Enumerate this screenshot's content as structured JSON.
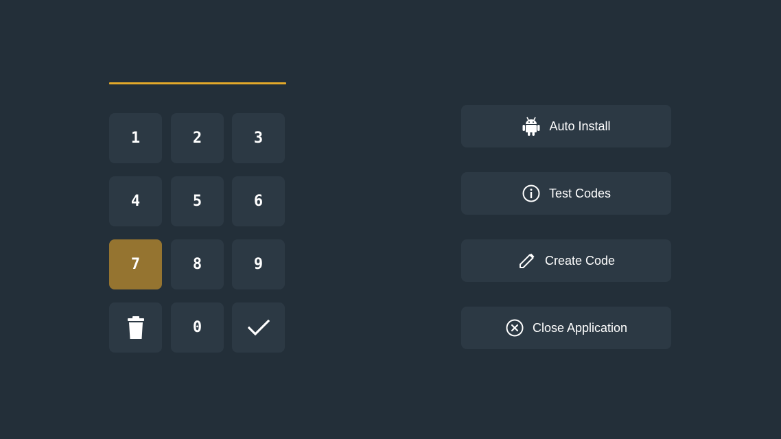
{
  "code_display": {
    "value": ""
  },
  "keypad": {
    "active_key": "7",
    "keys": [
      {
        "id": "1",
        "label": "1",
        "type": "digit"
      },
      {
        "id": "2",
        "label": "2",
        "type": "digit"
      },
      {
        "id": "3",
        "label": "3",
        "type": "digit"
      },
      {
        "id": "4",
        "label": "4",
        "type": "digit"
      },
      {
        "id": "5",
        "label": "5",
        "type": "digit"
      },
      {
        "id": "6",
        "label": "6",
        "type": "digit"
      },
      {
        "id": "7",
        "label": "7",
        "type": "digit"
      },
      {
        "id": "8",
        "label": "8",
        "type": "digit"
      },
      {
        "id": "9",
        "label": "9",
        "type": "digit"
      },
      {
        "id": "delete",
        "icon": "trash-icon",
        "type": "icon"
      },
      {
        "id": "0",
        "label": "0",
        "type": "digit"
      },
      {
        "id": "confirm",
        "icon": "checkmark-icon",
        "type": "icon"
      }
    ]
  },
  "actions": [
    {
      "id": "auto-install",
      "label": "Auto Install",
      "icon": "android-icon"
    },
    {
      "id": "test-codes",
      "label": "Test Codes",
      "icon": "info-icon"
    },
    {
      "id": "create-code",
      "label": "Create Code",
      "icon": "pencil-icon"
    },
    {
      "id": "close-application",
      "label": "Close Application",
      "icon": "close-circle-icon"
    }
  ],
  "colors": {
    "background": "#232f39",
    "button": "#2c3944",
    "accent": "#e3a92a",
    "active_key": "#957430",
    "text": "#ffffff"
  }
}
